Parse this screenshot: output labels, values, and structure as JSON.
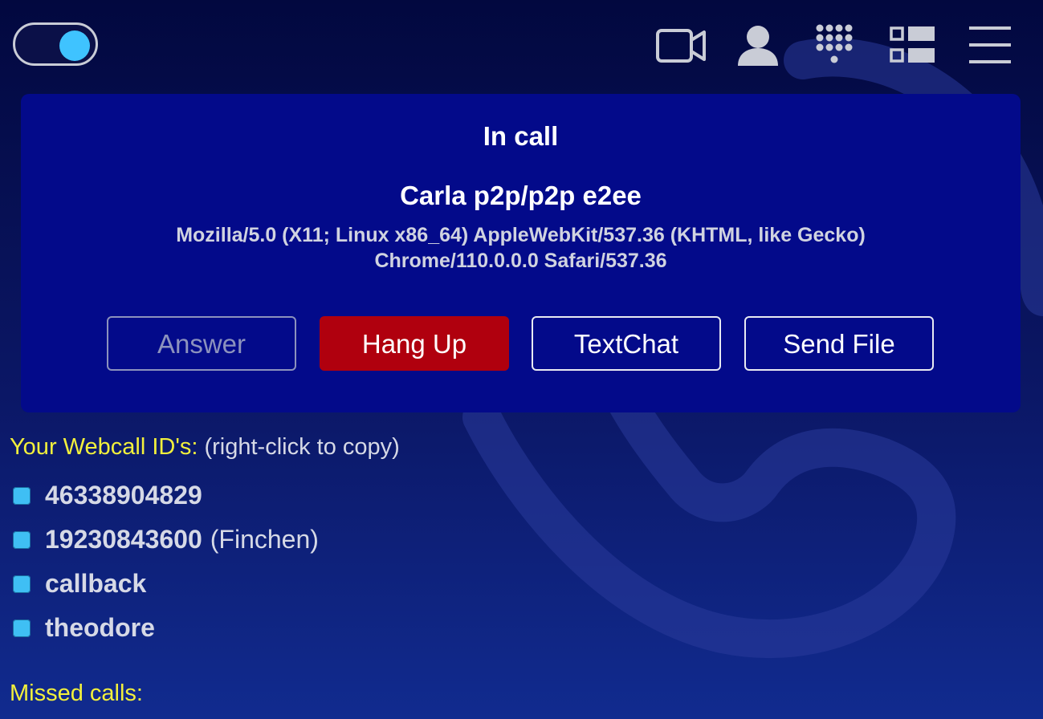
{
  "topbar": {
    "toggle_state": "on",
    "icons": [
      "video-camera-icon",
      "person-icon",
      "dialpad-icon",
      "layout-icon",
      "hamburger-menu-icon"
    ]
  },
  "call": {
    "status": "In call",
    "peer_name": "Carla p2p/p2p e2ee",
    "peer_agent": "Mozilla/5.0 (X11; Linux x86_64) AppleWebKit/537.36 (KHTML, like Gecko) Chrome/110.0.0.0 Safari/537.36",
    "buttons": {
      "answer": "Answer",
      "hangup": "Hang Up",
      "textchat": "TextChat",
      "sendfile": "Send File"
    }
  },
  "ids": {
    "heading": "Your Webcall ID's:",
    "hint": "(right-click to copy)",
    "items": [
      {
        "id": "46338904829",
        "alias": ""
      },
      {
        "id": "19230843600",
        "alias": "(Finchen)"
      },
      {
        "id": "callback",
        "alias": ""
      },
      {
        "id": "theodore",
        "alias": ""
      }
    ]
  },
  "missed": {
    "heading": "Missed calls:"
  },
  "colors": {
    "panel": "#030a8a",
    "hangup": "#b0000e",
    "accent": "#3fc3ff",
    "heading_yellow": "#f2f03c"
  }
}
